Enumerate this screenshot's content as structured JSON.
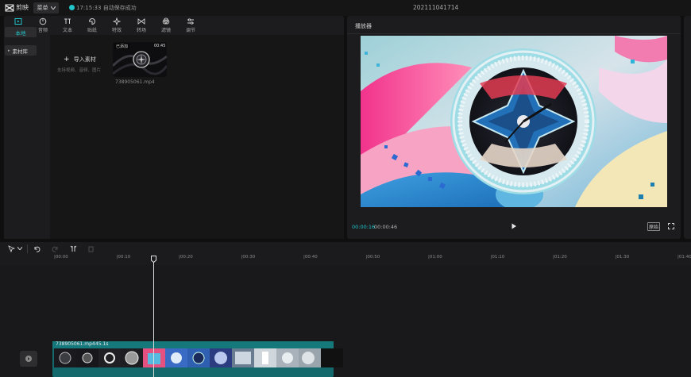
{
  "titlebar": {
    "app_name": "剪映",
    "menu_label": "菜单",
    "save_time": "17:15:33",
    "save_text": "自动保存成功",
    "project_title": "202111041714",
    "accent": "#21c4c9"
  },
  "toolbar": {
    "tools": [
      {
        "label": "媒体",
        "icon": "media-icon"
      },
      {
        "label": "音频",
        "icon": "audio-icon"
      },
      {
        "label": "文本",
        "icon": "text-icon"
      },
      {
        "label": "贴纸",
        "icon": "sticker-icon"
      },
      {
        "label": "特效",
        "icon": "effects-icon"
      },
      {
        "label": "转场",
        "icon": "transition-icon"
      },
      {
        "label": "滤镜",
        "icon": "filter-icon"
      },
      {
        "label": "调节",
        "icon": "adjust-icon"
      }
    ],
    "active": "媒体"
  },
  "sidebar": {
    "items": [
      {
        "label": "本地"
      },
      {
        "label": "素材库"
      }
    ]
  },
  "media": {
    "import_label": "导入素材",
    "import_hint": "支持视频、音频、图片",
    "clip_added_badge": "已添加",
    "clip_duration": "00:45",
    "clip_name": "738905061.mp4"
  },
  "player": {
    "title": "播放器",
    "time_current": "00:00:16",
    "time_total": "00:00:46",
    "ratio_label": "原始"
  },
  "timeline": {
    "ruler_labels": [
      "00:00",
      "00:10",
      "00:20",
      "00:30",
      "00:40",
      "00:50",
      "01:00",
      "01:10",
      "01:20",
      "01:30",
      "01:40"
    ],
    "clip_name": "738905061.mp4",
    "clip_duration": "45.1s",
    "playhead_time": "00:00:16"
  }
}
